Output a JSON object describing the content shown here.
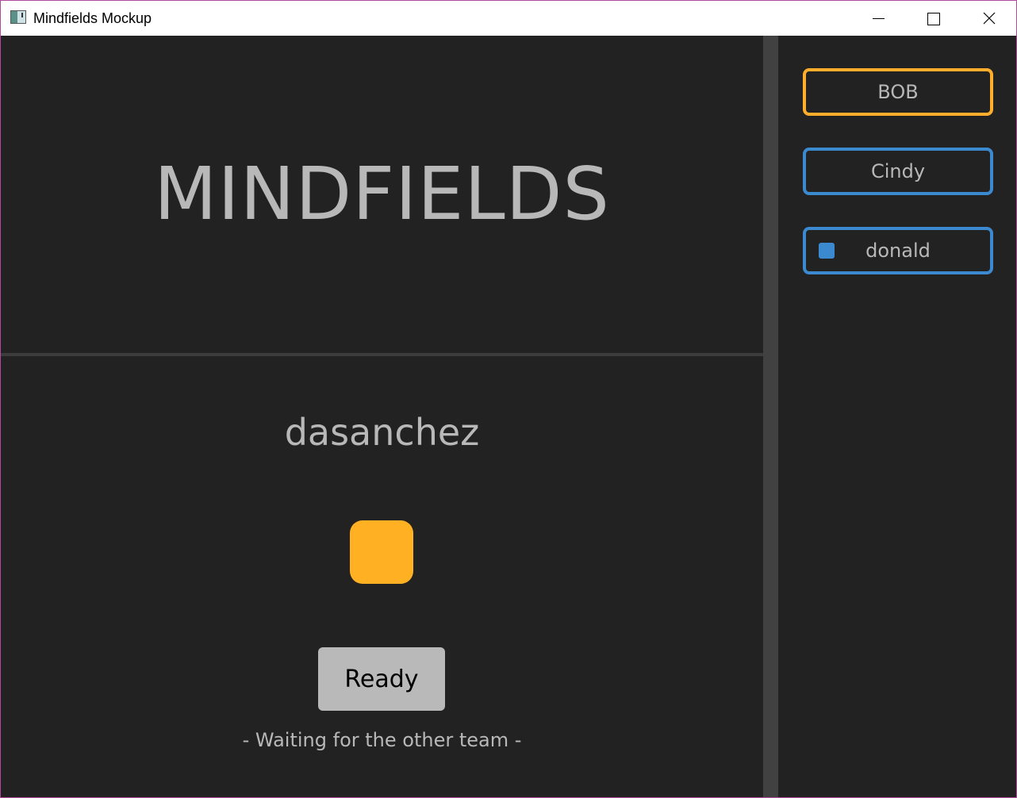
{
  "window": {
    "title": "Mindfields Mockup"
  },
  "main": {
    "app_title": "MINDFIELDS",
    "username": "dasanchez",
    "ready_label": "Ready",
    "status": "- Waiting for the other team -",
    "player_color": "#ffb023"
  },
  "players": [
    {
      "name": "BOB",
      "team_color": "#ffae2b"
    },
    {
      "name": "Cindy",
      "team_color": "#3b8ad0"
    },
    {
      "name": "donald",
      "team_color": "#3b8ad0",
      "marker_color": "#3b8ad0"
    }
  ],
  "colors": {
    "background": "#222222",
    "splitter": "#414141",
    "text": "#b8b8b8",
    "orange_team": "#ffae2b",
    "blue_team": "#3b8ad0"
  }
}
